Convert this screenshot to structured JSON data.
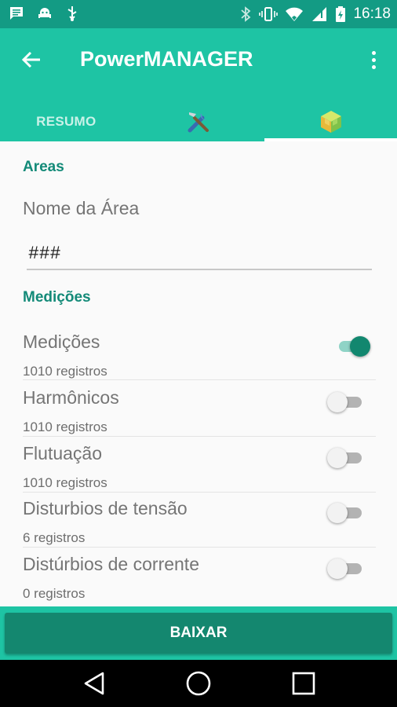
{
  "status_bar": {
    "time": "16:18"
  },
  "app_bar": {
    "title": "PowerMANAGER",
    "tabs": [
      {
        "label": "RESUMO"
      },
      {
        "icon": "tools-icon"
      },
      {
        "icon": "cube-icon",
        "active": true
      }
    ]
  },
  "areas": {
    "header": "Areas",
    "field_label": "Nome da Área",
    "field_value": "###"
  },
  "medicoes": {
    "header": "Medições",
    "items": [
      {
        "title": "Medições",
        "subtitle": "1010 registros",
        "enabled": true
      },
      {
        "title": "Harmônicos",
        "subtitle": "1010 registros",
        "enabled": false
      },
      {
        "title": "Flutuação",
        "subtitle": "1010 registros",
        "enabled": false
      },
      {
        "title": "Disturbios de tensão",
        "subtitle": "6 registros",
        "enabled": false
      },
      {
        "title": "Distúrbios de corrente",
        "subtitle": "0 registros",
        "enabled": false
      }
    ]
  },
  "actions": {
    "download_label": "BAIXAR"
  },
  "colors": {
    "primary": "#1ec4a4",
    "status_bar": "#139b84",
    "accent": "#12876f",
    "section_header": "#138a78"
  }
}
